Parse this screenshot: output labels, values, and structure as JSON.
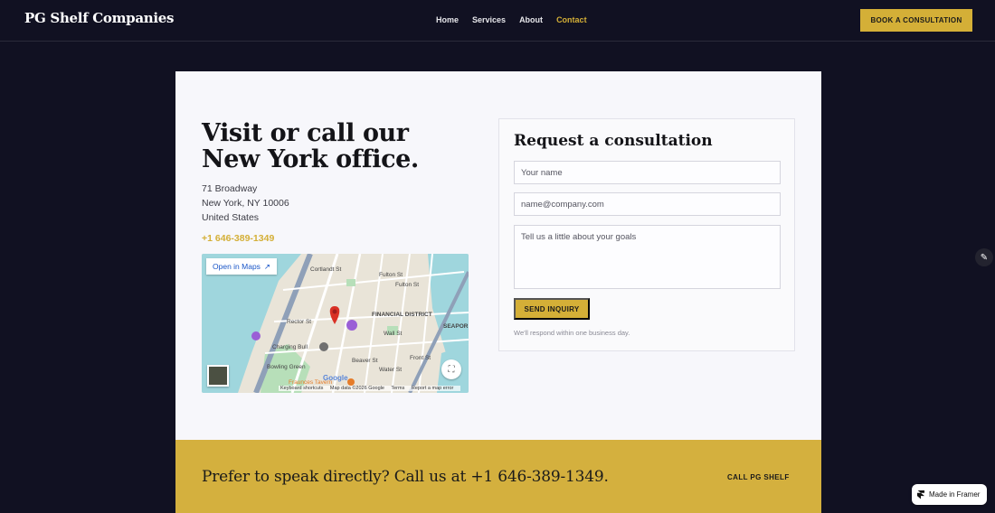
{
  "header": {
    "brand": "PG Shelf Companies",
    "nav": [
      {
        "label": "Home",
        "active": false
      },
      {
        "label": "Services",
        "active": false
      },
      {
        "label": "About",
        "active": false
      },
      {
        "label": "Contact",
        "active": true
      }
    ],
    "cta_label": "BOOK A CONSULTATION"
  },
  "office": {
    "headline": "Visit or call our New York office.",
    "address_line1": "71 Broadway",
    "address_line2": "New York, NY 10006",
    "address_line3": "United States",
    "phone": "+1 646-389-1349"
  },
  "map": {
    "open_label": "Open in Maps",
    "labels": [
      "Cortlandt St",
      "Fulton St",
      "Fulton St",
      "Rector St",
      "FINANCIAL DISTRICT",
      "Wall St",
      "SEAPOR",
      "Charging Bull",
      "Bowling Green",
      "Fraunces Tavern",
      "Beaver St",
      "Water St",
      "Front St"
    ],
    "footer": [
      "Keyboard shortcuts",
      "Map data ©2026 Google",
      "Terms",
      "Report a map error"
    ],
    "google": "Google"
  },
  "form": {
    "title": "Request a consultation",
    "name_placeholder": "Your name",
    "email_placeholder": "name@company.com",
    "message_placeholder": "Tell us a little about your goals",
    "submit_label": "SEND INQUIRY",
    "note": "We'll respond within one business day."
  },
  "band": {
    "text": "Prefer to speak directly? Call us at +1 646-389-1349.",
    "cta_label": "CALL PG SHELF"
  },
  "badge": {
    "label": "Made in Framer"
  },
  "colors": {
    "accent": "#d4af37",
    "background": "#111122",
    "card": "#f7f7fb"
  }
}
